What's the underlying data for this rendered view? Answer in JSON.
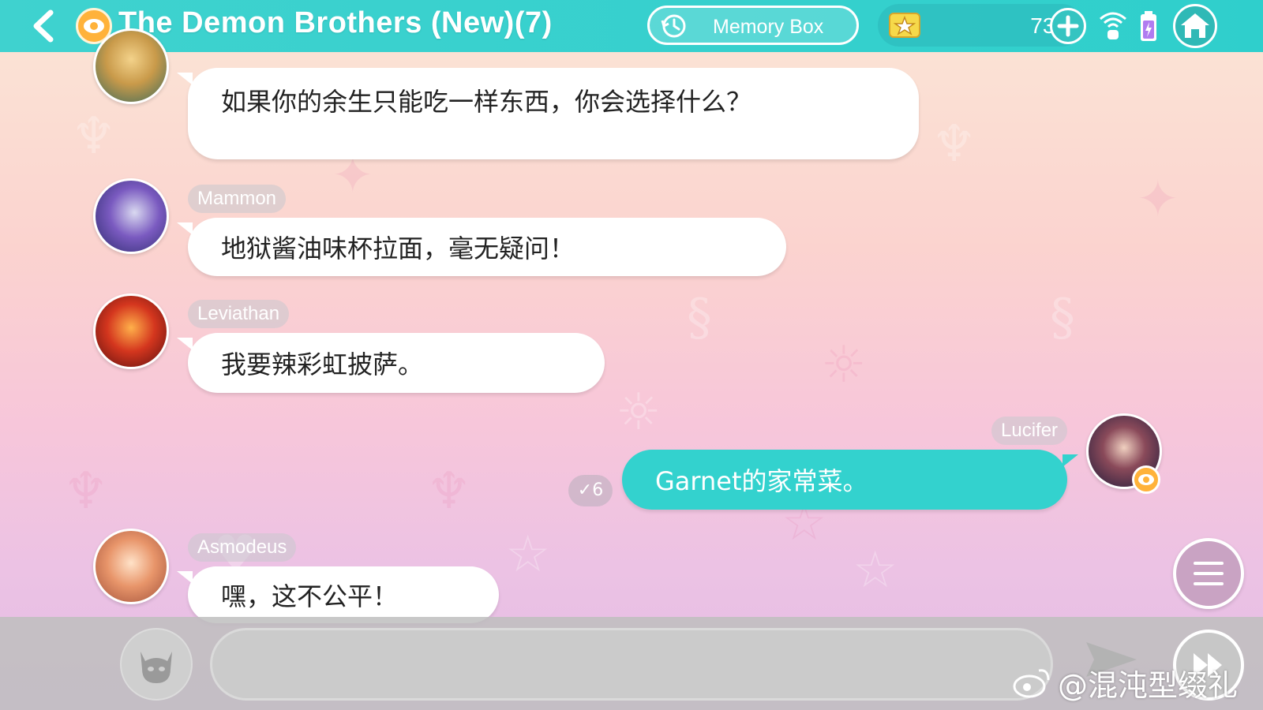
{
  "header": {
    "title": "The Demon Brothers (New)(7)",
    "memory_box_label": "Memory Box",
    "currency_value": "732"
  },
  "messages": [
    {
      "sender": "",
      "text": "如果你的余生只能吃一样东西，你会选择什么？",
      "mine": false
    },
    {
      "sender": "Mammon",
      "text": "地狱酱油味杯拉面，毫无疑问！",
      "mine": false
    },
    {
      "sender": "Leviathan",
      "text": "我要辣彩虹披萨。",
      "mine": false
    },
    {
      "sender": "Lucifer",
      "text": "Garnet的家常菜。",
      "mine": true,
      "read_count": "✓6"
    },
    {
      "sender": "Asmodeus",
      "text": "嘿，这不公平！",
      "mine": false
    }
  ],
  "input": {
    "value": "",
    "placeholder": ""
  },
  "watermark": "@混沌型缀礼",
  "colors": {
    "accent": "#33d2ce",
    "header": "#3fd2cf",
    "eye_badge": "#ffb23a",
    "bubble": "#ffffff"
  },
  "icons": {
    "back": "chevron-left-icon",
    "eye": "eye-icon",
    "memory": "history-clock-icon",
    "currency": "star-card-icon",
    "plus": "plus-icon",
    "wifi": "wifi-icon",
    "battery": "battery-icon",
    "home": "home-icon",
    "stamp": "devil-face-icon",
    "send": "send-icon",
    "menu": "hamburger-menu-icon",
    "skip": "fast-forward-icon"
  }
}
